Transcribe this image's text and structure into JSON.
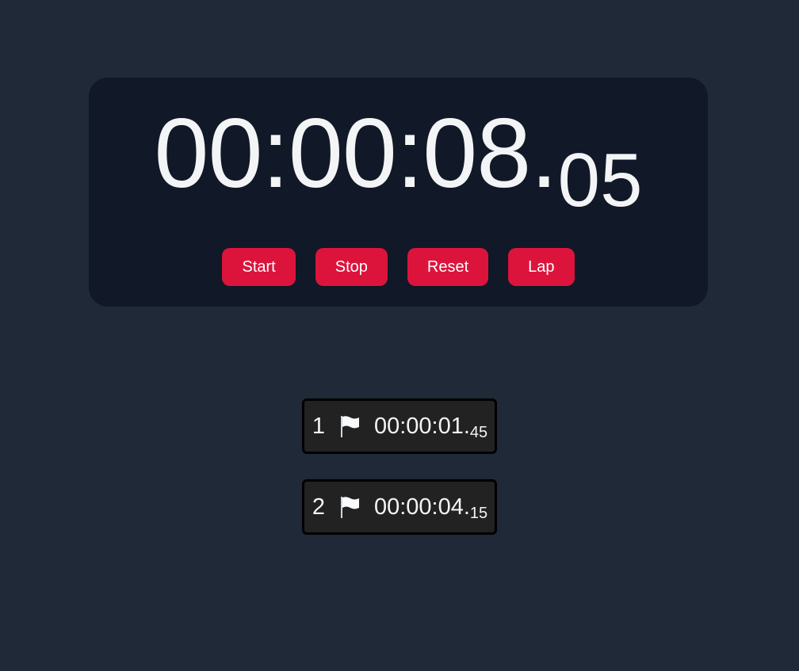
{
  "stopwatch": {
    "time_main": "00:00:08",
    "separator": ".",
    "time_ms": "05"
  },
  "controls": {
    "start_label": "Start",
    "stop_label": "Stop",
    "reset_label": "Reset",
    "lap_label": "Lap"
  },
  "laps": [
    {
      "index": "1",
      "icon": "flag-icon",
      "time_main": "00:00:01",
      "separator": ".",
      "time_ms": "45"
    },
    {
      "index": "2",
      "icon": "flag-icon",
      "time_main": "00:00:04",
      "separator": ".",
      "time_ms": "15"
    }
  ],
  "colors": {
    "background": "#1f2937",
    "card": "#111827",
    "accent": "#dc143c",
    "lap_background": "#222222"
  }
}
